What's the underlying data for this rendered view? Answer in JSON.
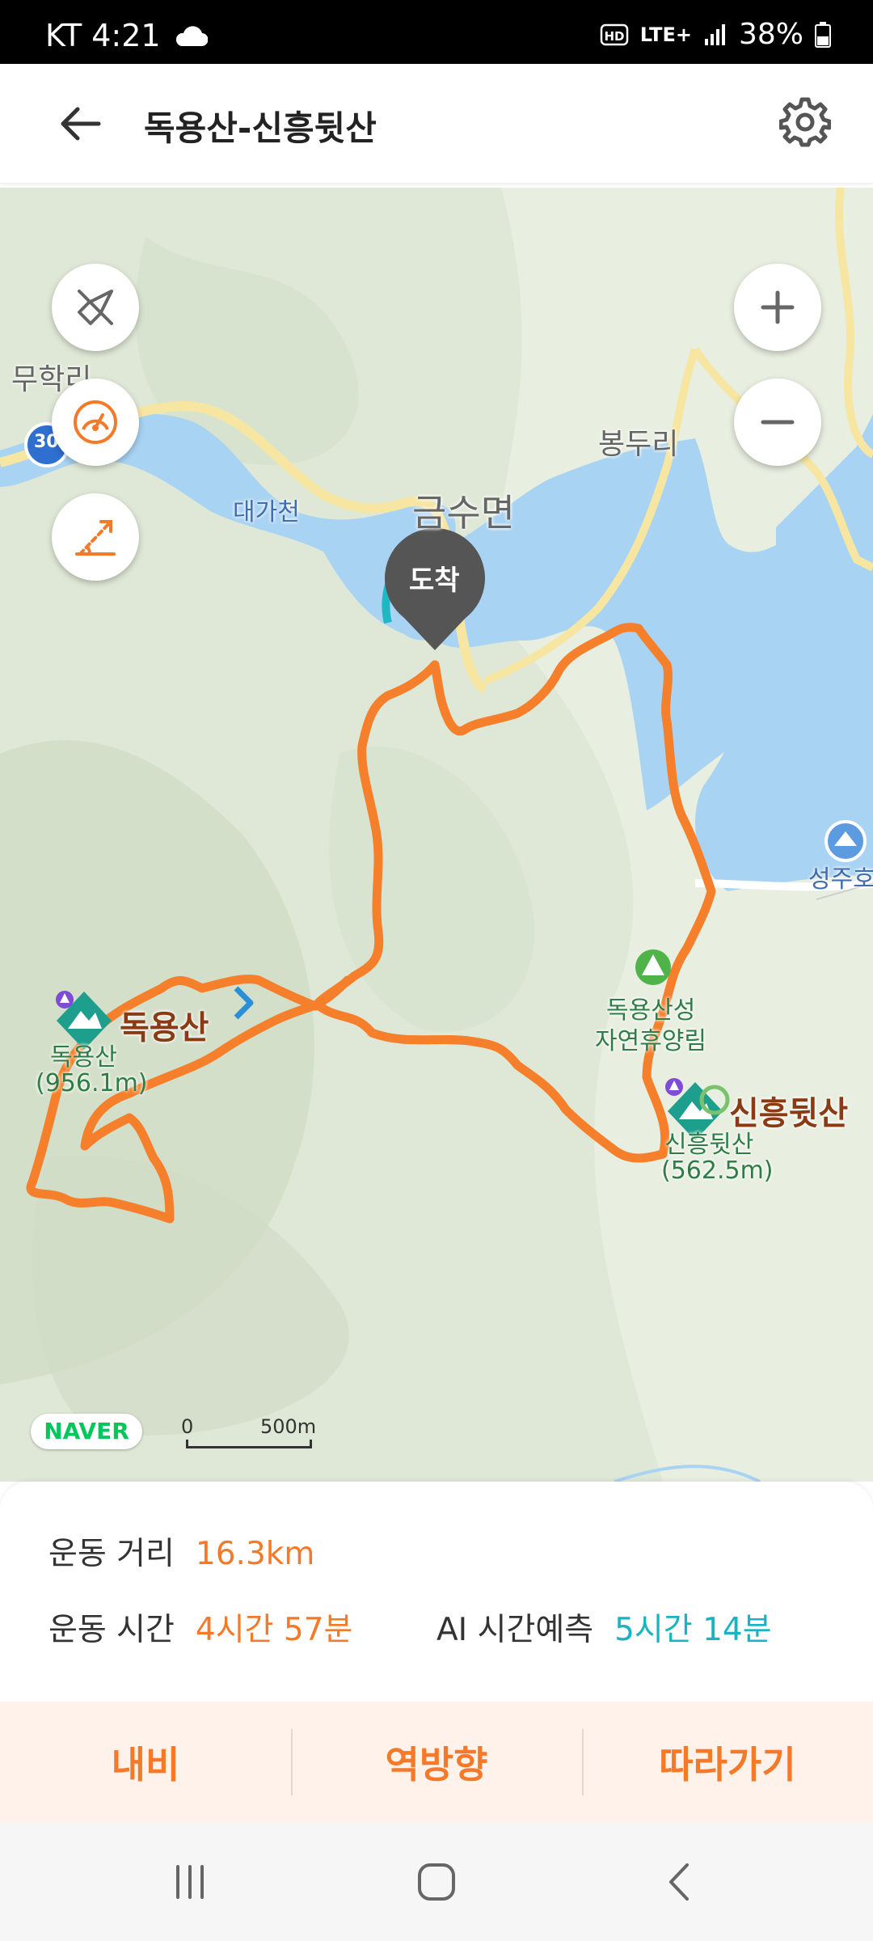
{
  "status": {
    "carrier_time": "KT 4:21",
    "battery": "38%",
    "network": "LTE+"
  },
  "header": {
    "title": "독용산-신흥뒷산"
  },
  "map": {
    "labels": {
      "muhak": "무학리",
      "route_no": "30",
      "daega": "대가천",
      "geumsu": "금수면",
      "bongduri": "봉두리",
      "dokyong_peak": "독용산",
      "dokyong_sub": "독용산",
      "dokyong_elev": "(956.1m)",
      "sinheung_peak": "신흥뒷산",
      "sinheung_sub": "신흥뒷산",
      "sinheung_elev": "(562.5m)",
      "forest1": "독용산성",
      "forest2": "자연휴양림",
      "seongju": "성주호",
      "arrival": "도착"
    },
    "brand": "NAVER",
    "scale_zero": "0",
    "scale_dist": "500m"
  },
  "stats": {
    "distance_label": "운동 거리",
    "distance_value": "16.3km",
    "time_label": "운동 시간",
    "time_value": "4시간 57분",
    "ai_label": "AI 시간예측",
    "ai_value": "5시간 14분"
  },
  "actions": {
    "navi": "내비",
    "reverse": "역방향",
    "follow": "따라가기"
  },
  "colors": {
    "route": "#f57f2a",
    "accent": "#f47a2a",
    "teal": "#19b3c1",
    "water": "#a9d3f2"
  }
}
